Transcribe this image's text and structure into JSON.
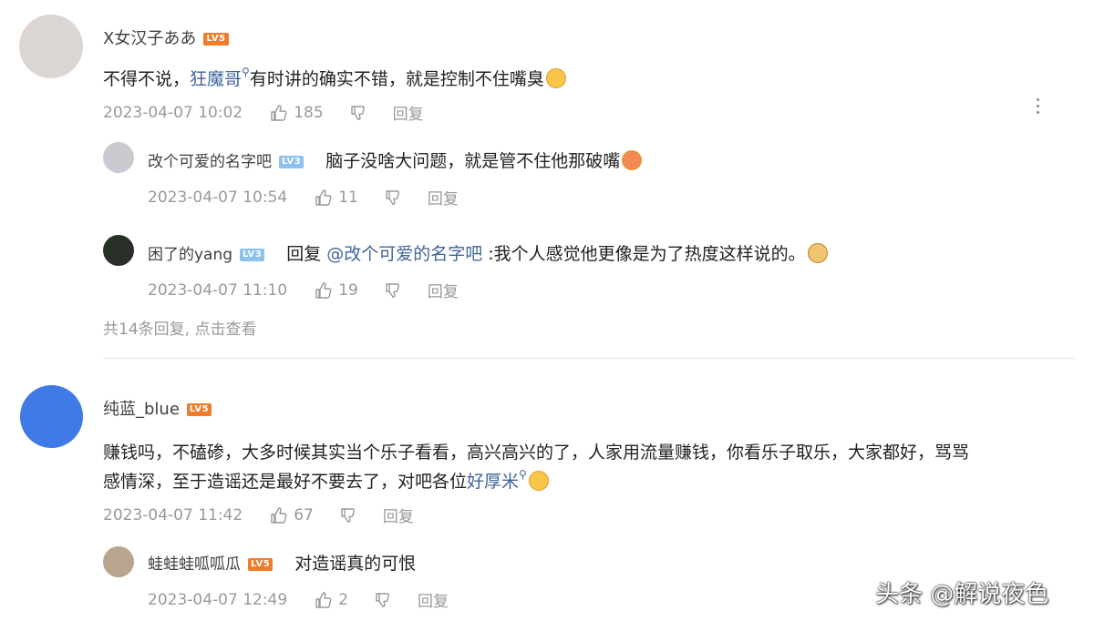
{
  "comments": [
    {
      "user": "X女汉子ああ",
      "level": "LV5",
      "text_before": "不得不说，",
      "mention": "狂魔哥",
      "text_after": "有时讲的确实不错，就是控制不住嘴臭",
      "time": "2023-04-07 10:02",
      "likes": "185",
      "reply_label": "回复"
    },
    {
      "user": "纯蓝_blue",
      "level": "LV5",
      "line1": "赚钱吗，不磕碜，大多时候其实当个乐子看看，高兴高兴的了，人家用流量赚钱，你看乐子取乐，大家都好，骂骂",
      "line2_before": "感情深，至于造谣还是最好不要去了，对吧各位",
      "mention": "好厚米",
      "time": "2023-04-07 11:42",
      "likes": "67",
      "reply_label": "回复"
    }
  ],
  "replies": [
    {
      "user": "改个可爱的名字吧",
      "level": "LV3",
      "text": "脑子没啥大问题，就是管不住他那破嘴",
      "time": "2023-04-07 10:54",
      "likes": "11",
      "reply_label": "回复"
    },
    {
      "user": "困了的yang",
      "level": "LV3",
      "prefix": "回复",
      "mention": "@改个可爱的名字吧",
      "text": ":我个人感觉他更像是为了热度这样说的。",
      "time": "2023-04-07 11:10",
      "likes": "19",
      "reply_label": "回复"
    },
    {
      "user": "蛙蛙蛙呱呱瓜",
      "level": "LV5",
      "text": "对造谣真的可恨",
      "time": "2023-04-07 12:49",
      "likes": "2",
      "reply_label": "回复"
    }
  ],
  "expand_text": "共14条回复, 点击查看",
  "watermark": "头条 @解说夜色",
  "icons": {
    "like": "thumbs-up-icon",
    "dislike": "thumbs-down-icon",
    "more": "more-vertical-icon",
    "search": "search-icon"
  },
  "colors": {
    "link": "#406599",
    "level5": "#f07b2b",
    "level3": "#8cc1f0",
    "meta": "#999999"
  }
}
